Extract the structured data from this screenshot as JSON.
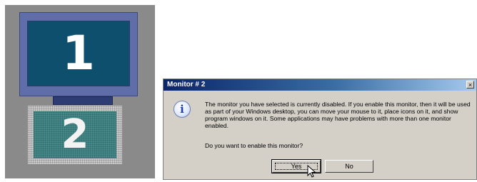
{
  "monitors": {
    "primary_number": "1",
    "secondary_number": "2"
  },
  "dialog": {
    "title": "Monitor # 2",
    "close_glyph": "×",
    "icon": "information-icon",
    "icon_glyph": "i",
    "message": "The monitor you have selected is currently disabled. If you enable this monitor, then it will be used as part of your Windows desktop, you can move your mouse to it, place icons on it, and show program windows on it. Some applications may have problems with more than one monitor enabled.",
    "question": "Do you want to enable this monitor?",
    "yes_label": "Yes",
    "no_label": "No"
  },
  "colors": {
    "panel_bg": "#8a8a8a",
    "monitor1_frame": "#5f6ea8",
    "monitor1_screen": "#0f4f6e",
    "monitor2_screen": "#4b8f8f",
    "dialog_face": "#d4d0c8",
    "titlebar_start": "#0a246a",
    "titlebar_end": "#a6caf0"
  }
}
